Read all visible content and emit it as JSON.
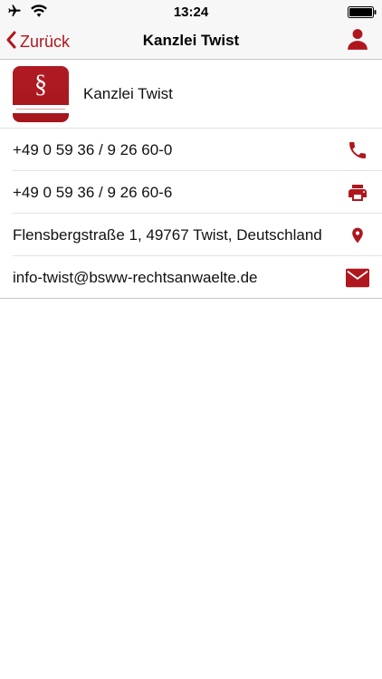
{
  "status_bar": {
    "time": "13:24",
    "icons": [
      "airplane-icon",
      "wifi-icon",
      "battery-icon"
    ]
  },
  "nav": {
    "back_label": "Zurück",
    "title": "Kanzlei Twist",
    "right_icon": "person-icon"
  },
  "header": {
    "name": "Kanzlei Twist",
    "logo_symbol": "§"
  },
  "contacts": [
    {
      "text": "+49 0 59 36 / 9 26 60-0",
      "icon": "phone-icon"
    },
    {
      "text": "+49 0 59 36 / 9 26 60-6",
      "icon": "fax-printer-icon"
    },
    {
      "text": "Flensbergstraße 1, 49767 Twist, Deutschland",
      "icon": "map-pin-icon"
    },
    {
      "text": "info-twist@bsww-rechtsanwaelte.de",
      "icon": "mail-icon"
    }
  ],
  "colors": {
    "accent": "#b0161d",
    "bar_background": "#f7f7f7",
    "separator": "#e3e3e3"
  }
}
